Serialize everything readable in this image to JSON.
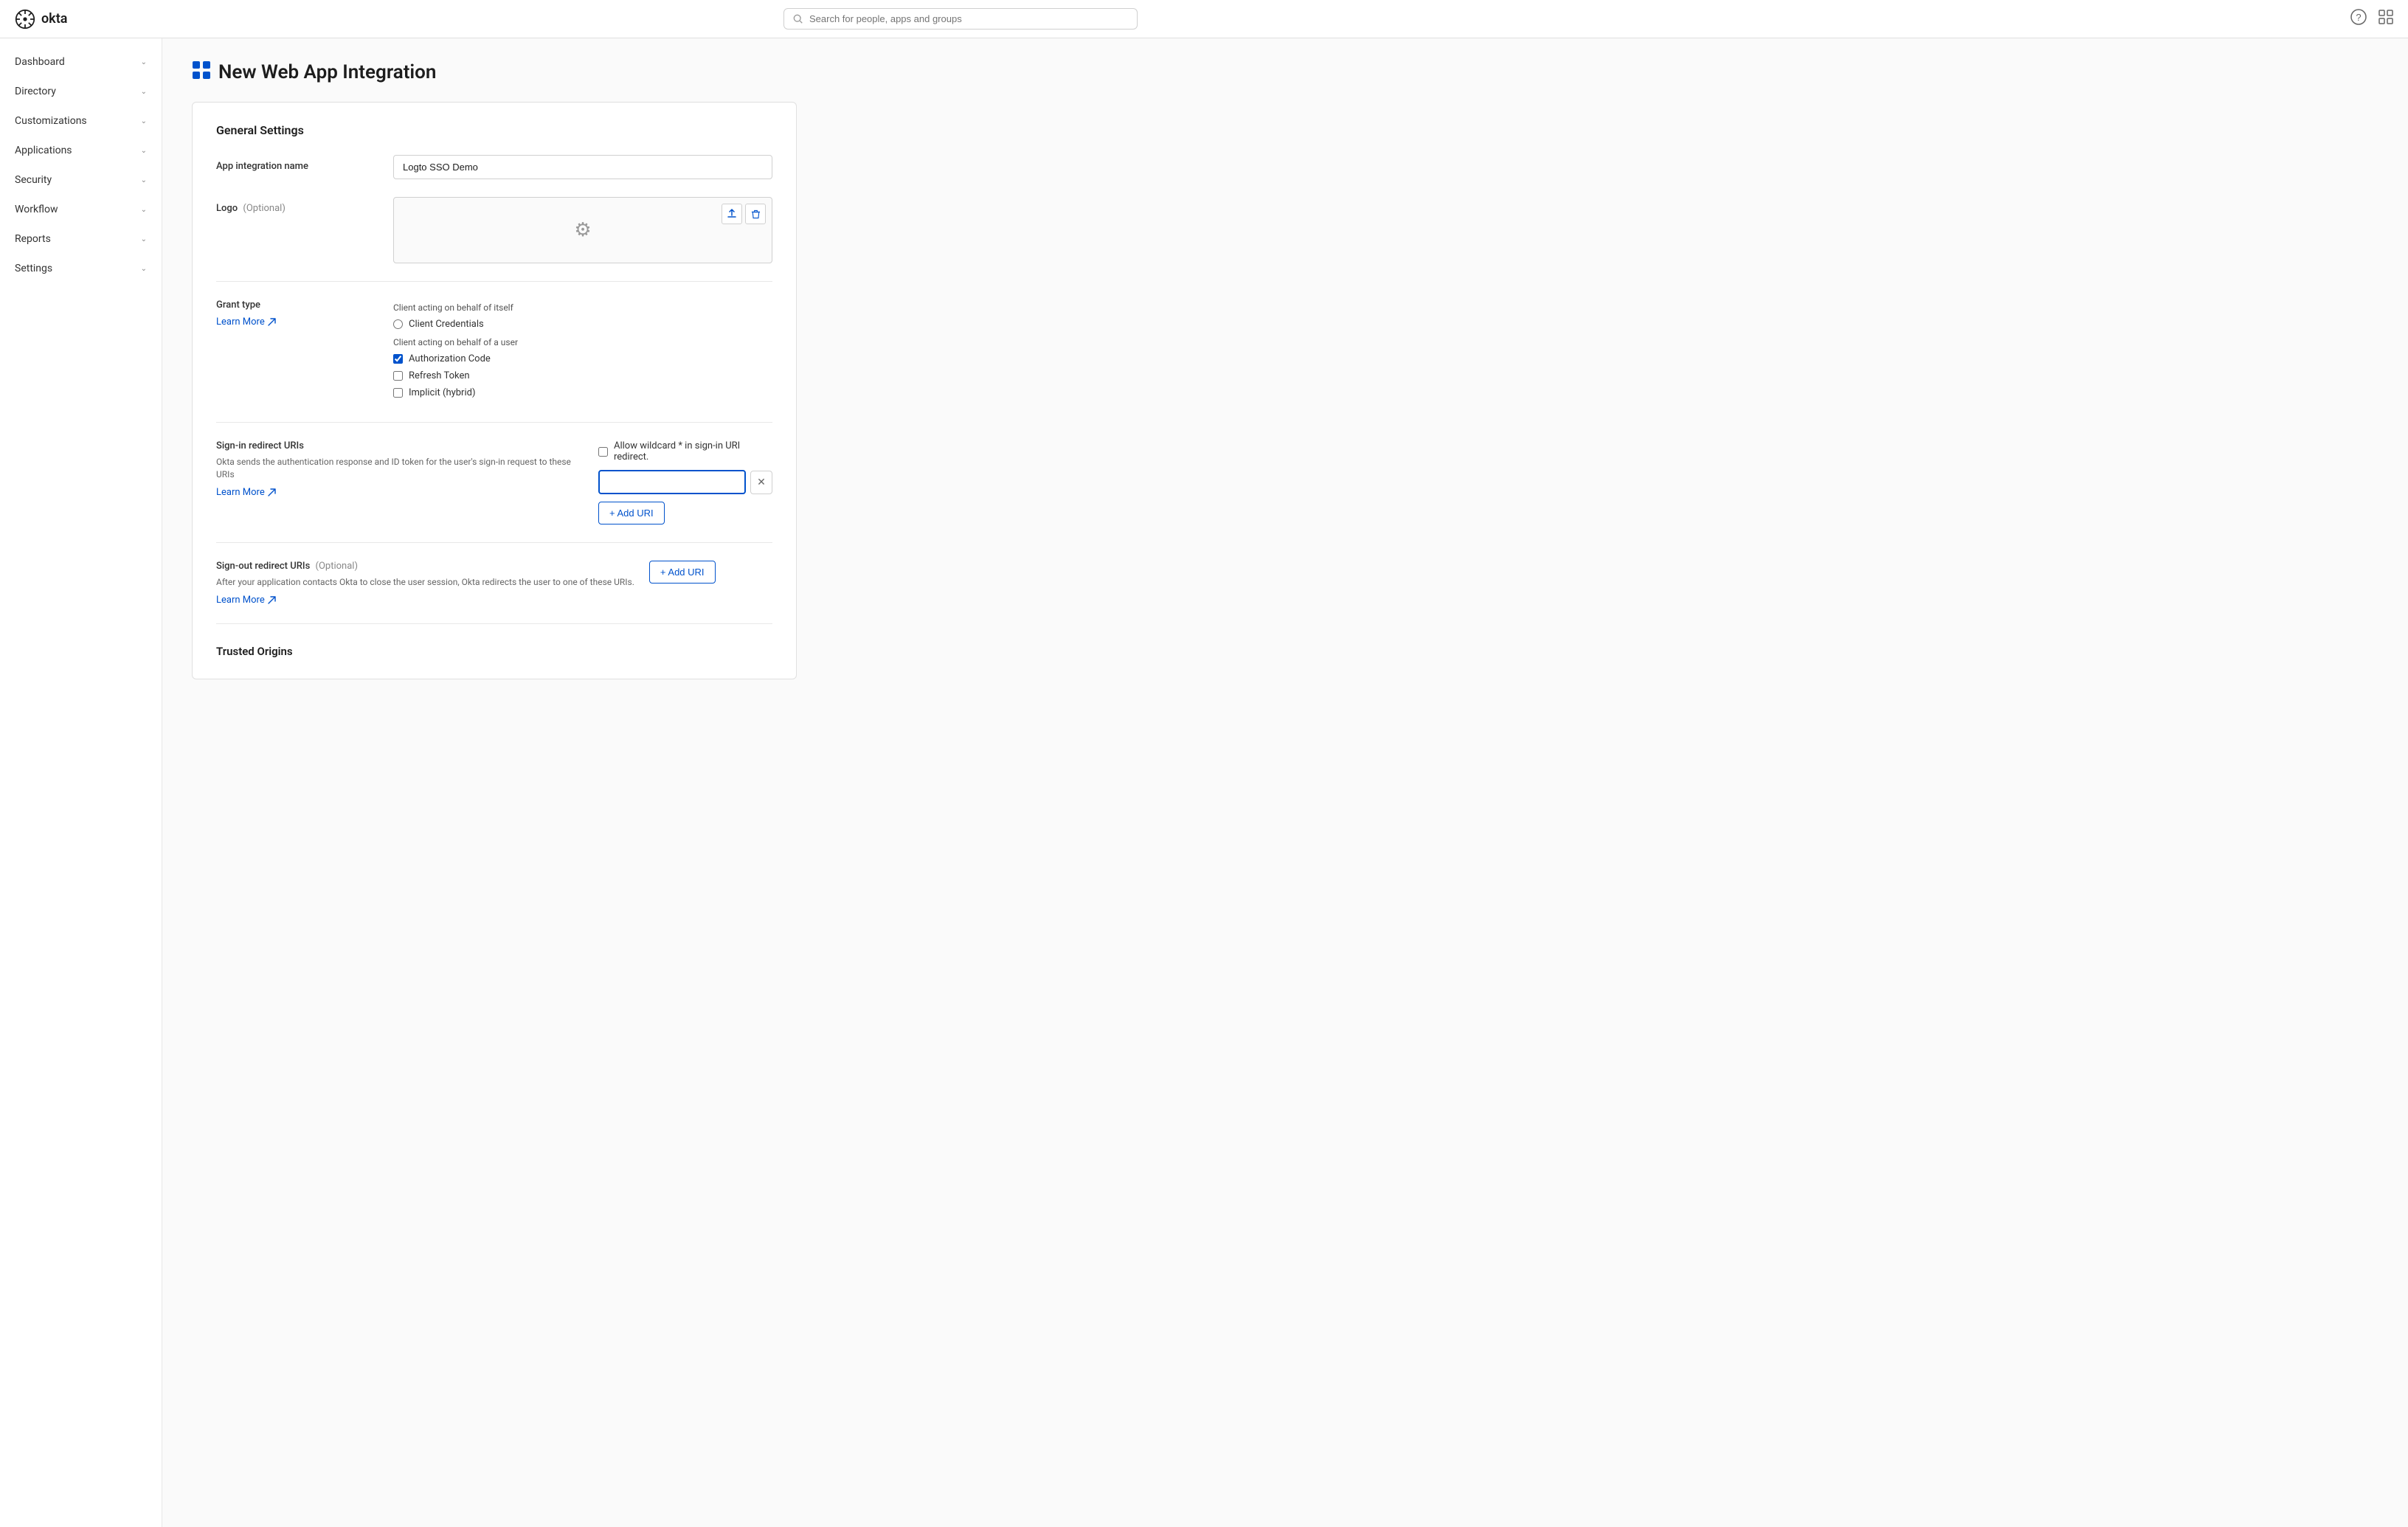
{
  "topnav": {
    "logo_text": "okta",
    "search_placeholder": "Search for people, apps and groups"
  },
  "sidebar": {
    "items": [
      {
        "id": "dashboard",
        "label": "Dashboard",
        "has_chevron": true
      },
      {
        "id": "directory",
        "label": "Directory",
        "has_chevron": true
      },
      {
        "id": "customizations",
        "label": "Customizations",
        "has_chevron": true
      },
      {
        "id": "applications",
        "label": "Applications",
        "has_chevron": true
      },
      {
        "id": "security",
        "label": "Security",
        "has_chevron": true
      },
      {
        "id": "workflow",
        "label": "Workflow",
        "has_chevron": true
      },
      {
        "id": "reports",
        "label": "Reports",
        "has_chevron": true
      },
      {
        "id": "settings",
        "label": "Settings",
        "has_chevron": true
      }
    ]
  },
  "page": {
    "title": "New Web App Integration",
    "card": {
      "section_title": "General Settings",
      "app_integration_name_label": "App integration name",
      "app_integration_name_value": "Logto SSO Demo",
      "logo_label": "Logo",
      "logo_optional": "(Optional)",
      "grant_type_label": "Grant type",
      "grant_type_learn_more": "Learn More",
      "client_acting_self_label": "Client acting on behalf of itself",
      "client_credentials_label": "Client Credentials",
      "client_acting_user_label": "Client acting on behalf of a user",
      "authorization_code_label": "Authorization Code",
      "refresh_token_label": "Refresh Token",
      "implicit_hybrid_label": "Implicit (hybrid)",
      "sign_in_redirect_label": "Sign-in redirect URIs",
      "sign_in_redirect_desc": "Okta sends the authentication response and ID token for the user's sign-in request to these URIs",
      "sign_in_learn_more": "Learn More",
      "allow_wildcard_label": "Allow wildcard * in sign-in URI redirect.",
      "add_uri_label": "+ Add URI",
      "sign_out_redirect_label": "Sign-out redirect URIs",
      "sign_out_optional": "(Optional)",
      "sign_out_desc": "After your application contacts Okta to close the user session, Okta redirects the user to one of these URIs.",
      "sign_out_learn_more": "Learn More",
      "sign_out_add_uri_label": "+ Add URI",
      "trusted_origins_label": "Trusted Origins"
    }
  }
}
